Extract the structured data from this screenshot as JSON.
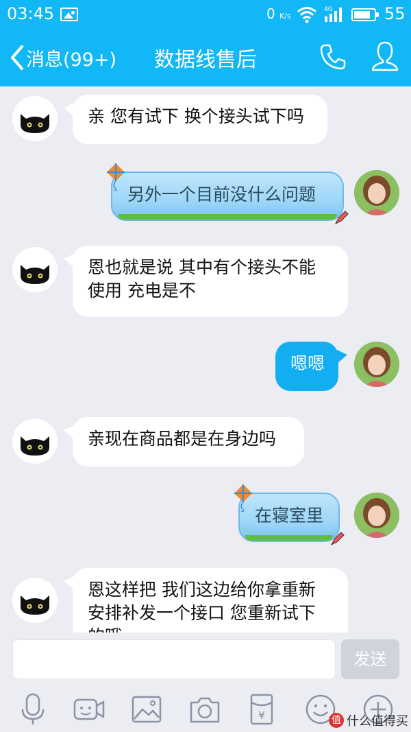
{
  "status_bar": {
    "time": "03:45",
    "net_speed": "0",
    "net_unit": "K/s",
    "network_type": "4G",
    "battery_level": "55"
  },
  "nav": {
    "back_label": "消息(99+)",
    "title": "数据线售后"
  },
  "messages": [
    {
      "side": "in",
      "avatar": "black-cat",
      "lines": [
        "亲 您有试下 换个接头试下吗"
      ]
    },
    {
      "side": "out",
      "style": "kite",
      "avatar": "girl",
      "lines": [
        "另外一个目前没什么问题"
      ]
    },
    {
      "side": "in",
      "avatar": "black-cat",
      "lines": [
        "恩也就是说 其中有个接头不能",
        "使用 充电是不"
      ]
    },
    {
      "side": "out",
      "style": "plain",
      "avatar": "girl",
      "lines": [
        "嗯嗯"
      ]
    },
    {
      "side": "in",
      "avatar": "black-cat",
      "lines": [
        "亲现在商品都是在身边吗"
      ]
    },
    {
      "side": "out",
      "style": "kite",
      "avatar": "girl",
      "lines": [
        "在寝室里"
      ]
    },
    {
      "side": "in",
      "avatar": "black-cat",
      "lines": [
        "恩这样把 我们这边给你拿重新",
        "安排补发一个接口 您重新试下",
        "的哦"
      ]
    }
  ],
  "composer": {
    "input_value": "",
    "send_label": "发送"
  },
  "toolbar": {
    "icons": [
      "microphone-icon",
      "video-camera-icon",
      "image-icon",
      "camera-icon",
      "red-packet-icon",
      "emoji-icon",
      "plus-icon"
    ],
    "red_packet_symbol": "¥"
  },
  "watermark": {
    "badge": "值",
    "text": "什么值得买"
  },
  "colors": {
    "header": "#12b7f5",
    "outgoing_bubble": "#13aef2",
    "background": "#ebedf3"
  }
}
